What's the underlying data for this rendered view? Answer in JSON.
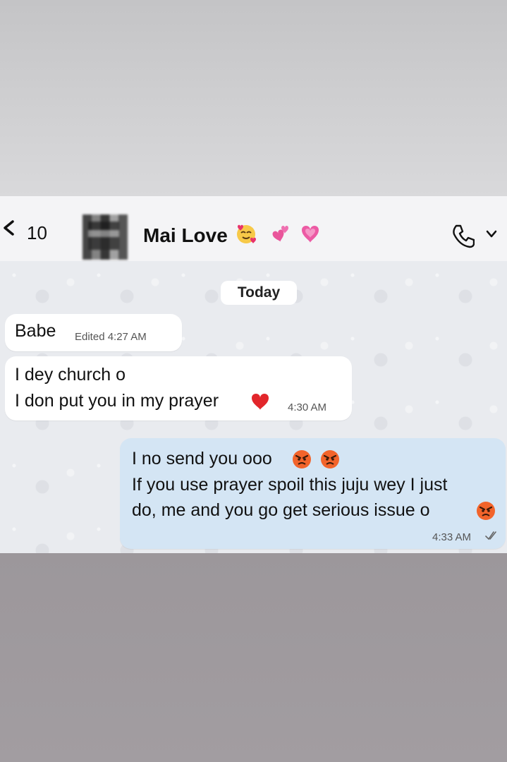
{
  "header": {
    "unread_count": "10",
    "contact_name": "Mai Love",
    "name_emojis": [
      "smiling-face-with-hearts-emoji",
      "two-hearts-emoji",
      "growing-heart-emoji"
    ],
    "icons": [
      "back-chevron-icon",
      "phone-icon",
      "chevron-down-icon"
    ]
  },
  "chat": {
    "date_label": "Today",
    "messages": [
      {
        "direction": "incoming",
        "lines": [
          "Babe"
        ],
        "meta": "Edited 4:27 AM"
      },
      {
        "direction": "incoming",
        "lines": [
          "I dey church o",
          "I don put you in my prayer"
        ],
        "trailing_emoji": "red-heart-emoji",
        "meta": "4:30 AM"
      },
      {
        "direction": "outgoing",
        "lines": [
          "I no send you ooo",
          "If you use prayer spoil this juju wey I just",
          "do, me and you go get serious issue o"
        ],
        "emojis": [
          "angry-face-emoji",
          "angry-face-emoji",
          "angry-face-emoji"
        ],
        "meta": "4:33 AM",
        "status": "read-double-tick-icon"
      }
    ]
  },
  "colors": {
    "incoming_bubble": "#ffffff",
    "outgoing_bubble": "#d4e5f4",
    "chat_background": "#e9ebef",
    "header_background": "#f4f4f6"
  }
}
